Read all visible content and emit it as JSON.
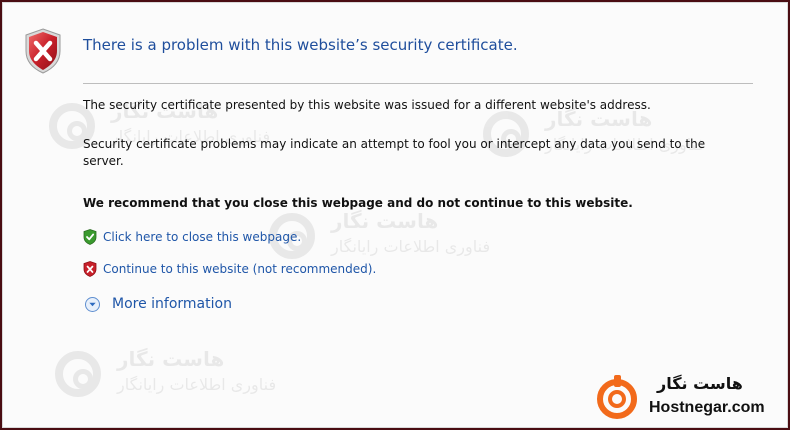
{
  "page": {
    "title": "There is a problem with this website’s security certificate.",
    "paragraph1": "The security certificate presented by this website was issued for a different website's address.",
    "paragraph2": "Security certificate problems may indicate an attempt to fool you or intercept any data you send to the server.",
    "recommendation": "We recommend that you close this webpage and do not continue to this website.",
    "close_link": "Click here to close this webpage.",
    "continue_link": "Continue to this website (not recommended).",
    "more_info": "More information"
  },
  "icons": {
    "header": "error-shield-icon",
    "close_link": "green-shield-check-icon",
    "continue_link": "red-shield-x-icon",
    "more_info": "chevron-down-circle-icon"
  },
  "colors": {
    "title": "#1f4e9c",
    "link": "#1f56a8",
    "shield_red": "#c8202a",
    "shield_green": "#3a9a2e",
    "brand_orange": "#f26a1b",
    "outer_border": "#4a0d12"
  },
  "watermark": {
    "line1": "هاست نگار",
    "line2": "فناوری اطلاعات رایانگار"
  },
  "brand": {
    "name_fa": "هاست نگار",
    "name_en": "Hostnegar.com"
  }
}
